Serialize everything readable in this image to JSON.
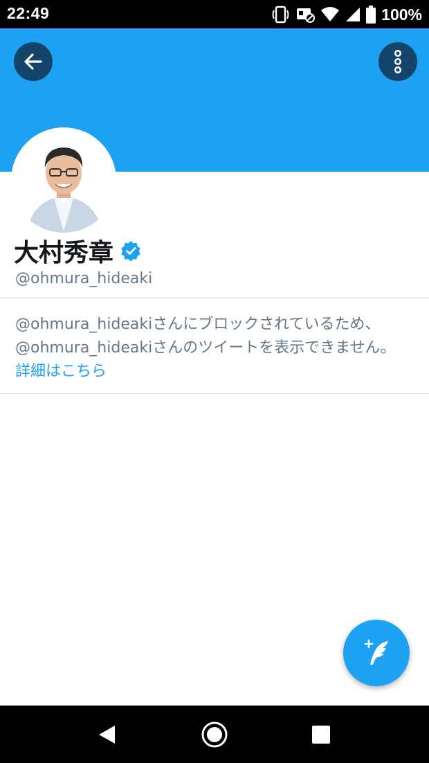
{
  "status_bar": {
    "time": "22:49",
    "battery": "100%"
  },
  "profile": {
    "name": "大村秀章",
    "handle": "@ohmura_hideaki",
    "verified": true
  },
  "block_notice": {
    "line1": "@ohmura_hideakiさんにブロックされているため、",
    "line2": "@ohmura_hideakiさんのツイートを表示できません。",
    "link": "詳細はこちら"
  },
  "colors": {
    "banner": "#1da1f2",
    "accent": "#1da1f2",
    "button_dark": "#15446a"
  },
  "icons": {
    "back": "arrow-left-icon",
    "more": "more-vertical-icon",
    "compose": "compose-feather-icon",
    "verified": "verified-badge-icon"
  }
}
